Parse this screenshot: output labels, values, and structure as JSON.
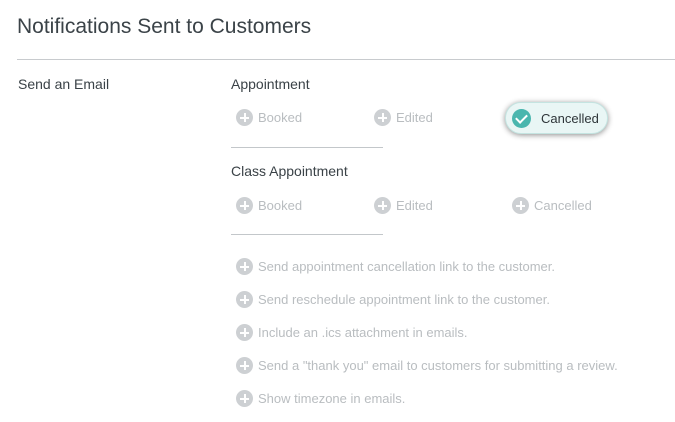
{
  "page": {
    "title": "Notifications Sent to Customers"
  },
  "row": {
    "label": "Send an Email"
  },
  "appointment": {
    "heading": "Appointment",
    "booked": "Booked",
    "edited": "Edited",
    "cancelled": "Cancelled",
    "cancelled_selected": true
  },
  "class_appointment": {
    "heading": "Class Appointment",
    "booked": "Booked",
    "edited": "Edited",
    "cancelled": "Cancelled"
  },
  "options": [
    "Send appointment cancellation link to the customer.",
    "Send reschedule appointment link to the customer.",
    "Include an .ics attachment in emails.",
    "Send a \"thank you\" email to customers for submitting a review.",
    "Show timezone in emails."
  ],
  "colors": {
    "accent": "#4ab6ae",
    "selected_bg": "#e9f6f5",
    "inactive_text": "#b9bdc0",
    "inactive_icon": "#cdd0d3"
  }
}
